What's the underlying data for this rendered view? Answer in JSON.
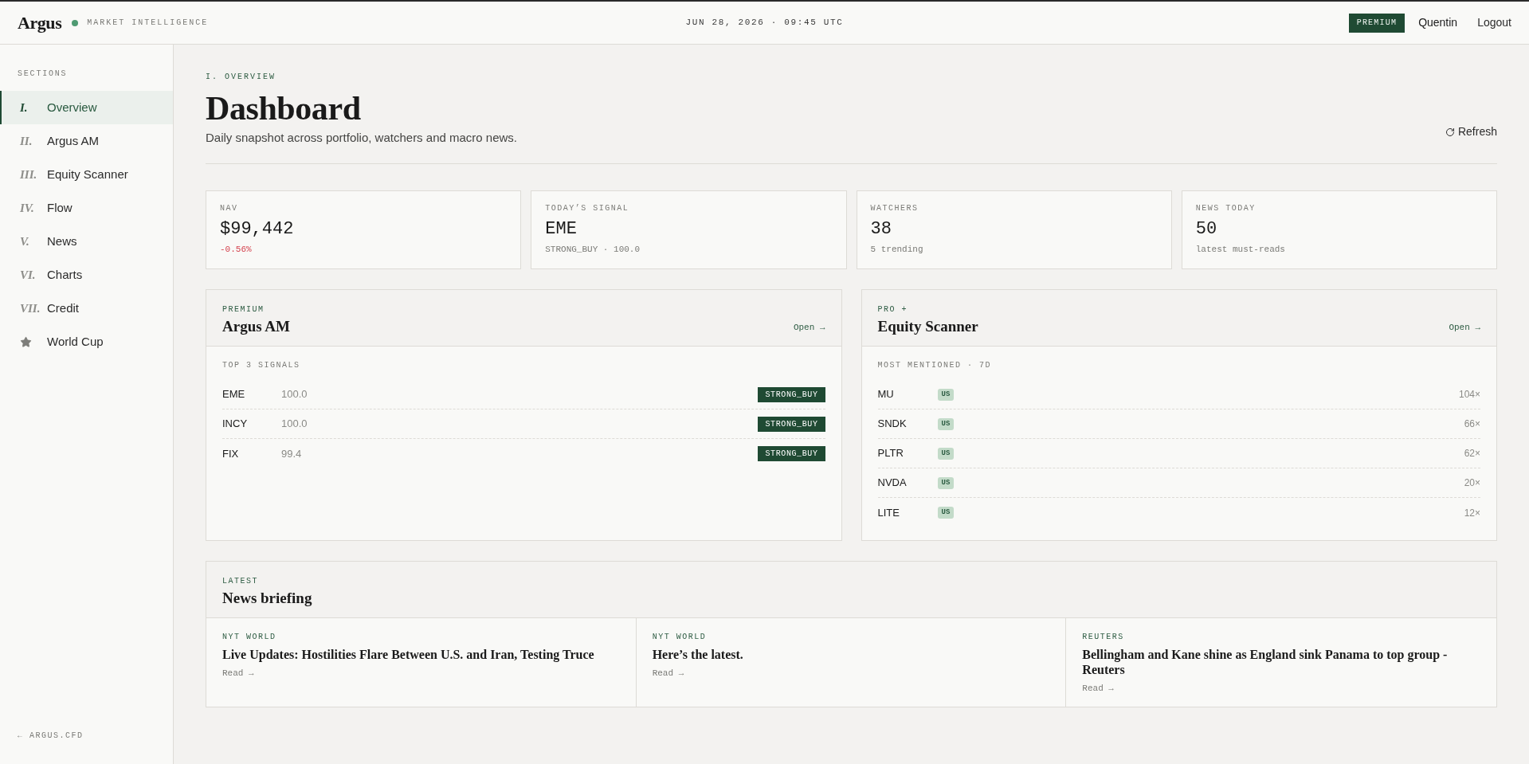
{
  "top_bar": {
    "brand": "Argus",
    "tagline": "MARKET INTELLIGENCE",
    "datetime": "JUN 28, 2026 · 09:45 UTC",
    "plan_badge": "PREMIUM",
    "user": "Quentin",
    "logout": "Logout"
  },
  "sidebar": {
    "heading": "SECTIONS",
    "items": [
      {
        "kind": "numeral",
        "numeral": "I.",
        "label": "Overview",
        "selected": true
      },
      {
        "kind": "numeral",
        "numeral": "II.",
        "label": "Argus AM",
        "selected": false
      },
      {
        "kind": "numeral",
        "numeral": "III.",
        "label": "Equity Scanner",
        "selected": false
      },
      {
        "kind": "numeral",
        "numeral": "IV.",
        "label": "Flow",
        "selected": false
      },
      {
        "kind": "numeral",
        "numeral": "V.",
        "label": "News",
        "selected": false
      },
      {
        "kind": "numeral",
        "numeral": "VI.",
        "label": "Charts",
        "selected": false
      },
      {
        "kind": "numeral",
        "numeral": "VII.",
        "label": "Credit",
        "selected": false
      },
      {
        "kind": "star",
        "label": "World Cup",
        "selected": false
      }
    ],
    "footer_link": "← ARGUS.CFD"
  },
  "header": {
    "eyebrow": "I. OVERVIEW",
    "title": "Dashboard",
    "subtitle": "Daily snapshot across portfolio, watchers and macro news.",
    "refresh_button": "Refresh"
  },
  "stats": [
    {
      "label": "NAV",
      "value": "$99,442",
      "note": "-0.56%",
      "negative": true
    },
    {
      "label": "TODAY’S SIGNAL",
      "value": "EME",
      "note": "STRONG_BUY · 100.0",
      "negative": false
    },
    {
      "label": "WATCHERS",
      "value": "38",
      "note": "5 trending",
      "negative": false
    },
    {
      "label": "NEWS TODAY",
      "value": "50",
      "note": "latest must-reads",
      "negative": false
    }
  ],
  "panels": [
    {
      "kind": "signals",
      "eyebrow": "PREMIUM",
      "title": "Argus AM",
      "link": "Open →",
      "section_label": "TOP 3 SIGNALS",
      "rows": [
        {
          "ticker": "EME",
          "score": "100.0",
          "signal": "STRONG_BUY"
        },
        {
          "ticker": "INCY",
          "score": "100.0",
          "signal": "STRONG_BUY"
        },
        {
          "ticker": "FIX",
          "score": "99.4",
          "signal": "STRONG_BUY"
        }
      ]
    },
    {
      "kind": "mentions",
      "eyebrow": "PRO +",
      "title": "Equity Scanner",
      "link": "Open →",
      "section_label": "MOST MENTIONED · 7D",
      "rows": [
        {
          "ticker": "MU",
          "market": "US",
          "count": "104×"
        },
        {
          "ticker": "SNDK",
          "market": "US",
          "count": "66×"
        },
        {
          "ticker": "PLTR",
          "market": "US",
          "count": "62×"
        },
        {
          "ticker": "NVDA",
          "market": "US",
          "count": "20×"
        },
        {
          "ticker": "LITE",
          "market": "US",
          "count": "12×"
        }
      ]
    }
  ],
  "news": {
    "eyebrow": "LATEST",
    "title": "News briefing",
    "items": [
      {
        "source": "NYT WORLD",
        "headline": "Live Updates: Hostilities Flare Between U.S. and Iran, Testing Truce",
        "link": "Read →"
      },
      {
        "source": "NYT WORLD",
        "headline": "Here’s the latest.",
        "link": "Read →"
      },
      {
        "source": "REUTERS",
        "headline": "Bellingham and Kane shine as England sink Panama to top group - Reuters",
        "link": "Read →"
      }
    ]
  }
}
